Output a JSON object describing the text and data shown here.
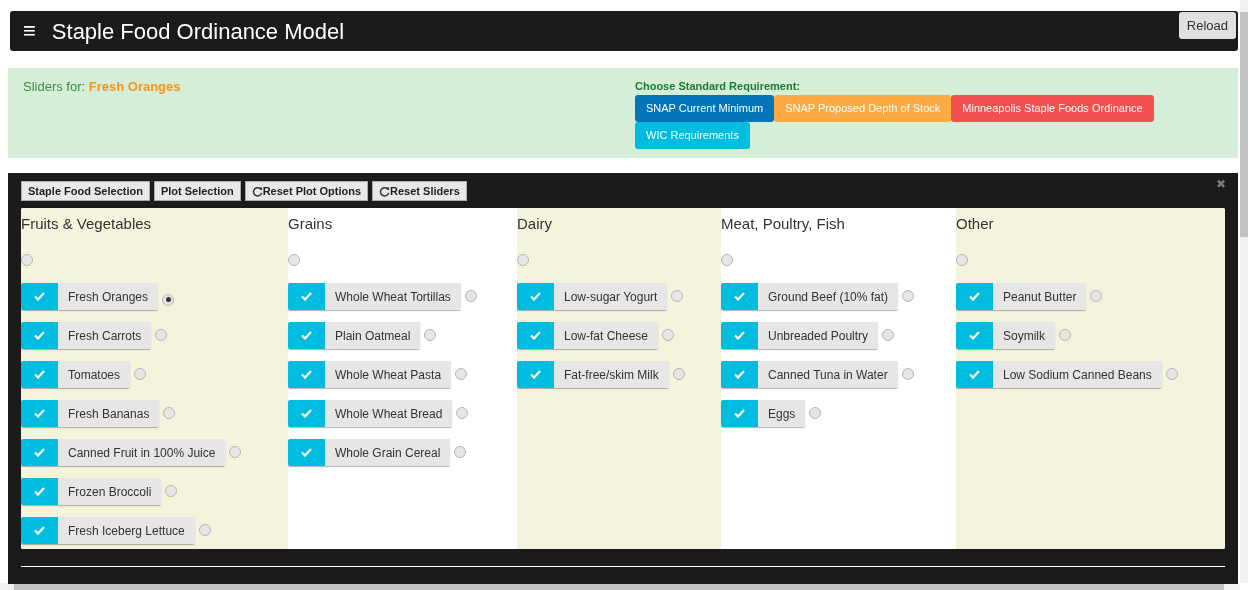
{
  "header": {
    "menu_icon": "≡",
    "title": "Staple Food Ordinance Model",
    "reload_button": "Reload"
  },
  "sliders_panel": {
    "label": "Sliders for:",
    "food": "Fresh Oranges",
    "standard_title": "Choose Standard Requirement:",
    "standards": [
      {
        "label": "SNAP Current Minimum",
        "color": "#0275b8"
      },
      {
        "label": "SNAP Proposed Depth of Stock",
        "color": "#fbaa44"
      },
      {
        "label": "Minneapolis Staple Foods Ordinance",
        "color": "#f2504f"
      },
      {
        "label": "WIC Requirements",
        "color": "#00bcdf"
      }
    ]
  },
  "toolbar": [
    {
      "label": "Staple Food Selection",
      "kind": "plain"
    },
    {
      "label": "Plot Selection",
      "kind": "plain"
    },
    {
      "label": "Reset Plot Options",
      "kind": "reset"
    },
    {
      "label": "Reset Sliders",
      "kind": "reset"
    }
  ],
  "close_icon": "✖",
  "categories": [
    {
      "name": "Fruits & Vegetables",
      "selected": false,
      "items": [
        {
          "label": "Fresh Oranges",
          "checked": true,
          "selected": true
        },
        {
          "label": "Fresh Carrots",
          "checked": true,
          "selected": false
        },
        {
          "label": "Tomatoes",
          "checked": true,
          "selected": false
        },
        {
          "label": "Fresh Bananas",
          "checked": true,
          "selected": false
        },
        {
          "label": "Canned Fruit in 100% Juice",
          "checked": true,
          "selected": false
        },
        {
          "label": "Frozen Broccoli",
          "checked": true,
          "selected": false
        },
        {
          "label": "Fresh Iceberg Lettuce",
          "checked": true,
          "selected": false
        }
      ]
    },
    {
      "name": "Grains",
      "selected": false,
      "items": [
        {
          "label": "Whole Wheat Tortillas",
          "checked": true,
          "selected": false
        },
        {
          "label": "Plain Oatmeal",
          "checked": true,
          "selected": false
        },
        {
          "label": "Whole Wheat Pasta",
          "checked": true,
          "selected": false
        },
        {
          "label": "Whole Wheat Bread",
          "checked": true,
          "selected": false
        },
        {
          "label": "Whole Grain Cereal",
          "checked": true,
          "selected": false
        }
      ]
    },
    {
      "name": "Dairy",
      "selected": false,
      "items": [
        {
          "label": "Low-sugar Yogurt",
          "checked": true,
          "selected": false
        },
        {
          "label": "Low-fat Cheese",
          "checked": true,
          "selected": false
        },
        {
          "label": "Fat-free/skim Milk",
          "checked": true,
          "selected": false
        }
      ]
    },
    {
      "name": "Meat, Poultry, Fish",
      "selected": false,
      "items": [
        {
          "label": "Ground Beef (10% fat)",
          "checked": true,
          "selected": false
        },
        {
          "label": "Unbreaded Poultry",
          "checked": true,
          "selected": false
        },
        {
          "label": "Canned Tuna in Water",
          "checked": true,
          "selected": false
        },
        {
          "label": "Eggs",
          "checked": true,
          "selected": false
        }
      ]
    },
    {
      "name": "Other",
      "selected": false,
      "items": [
        {
          "label": "Peanut Butter",
          "checked": true,
          "selected": false
        },
        {
          "label": "Soymilk",
          "checked": true,
          "selected": false
        },
        {
          "label": "Low Sodium Canned Beans",
          "checked": true,
          "selected": false
        }
      ]
    }
  ]
}
